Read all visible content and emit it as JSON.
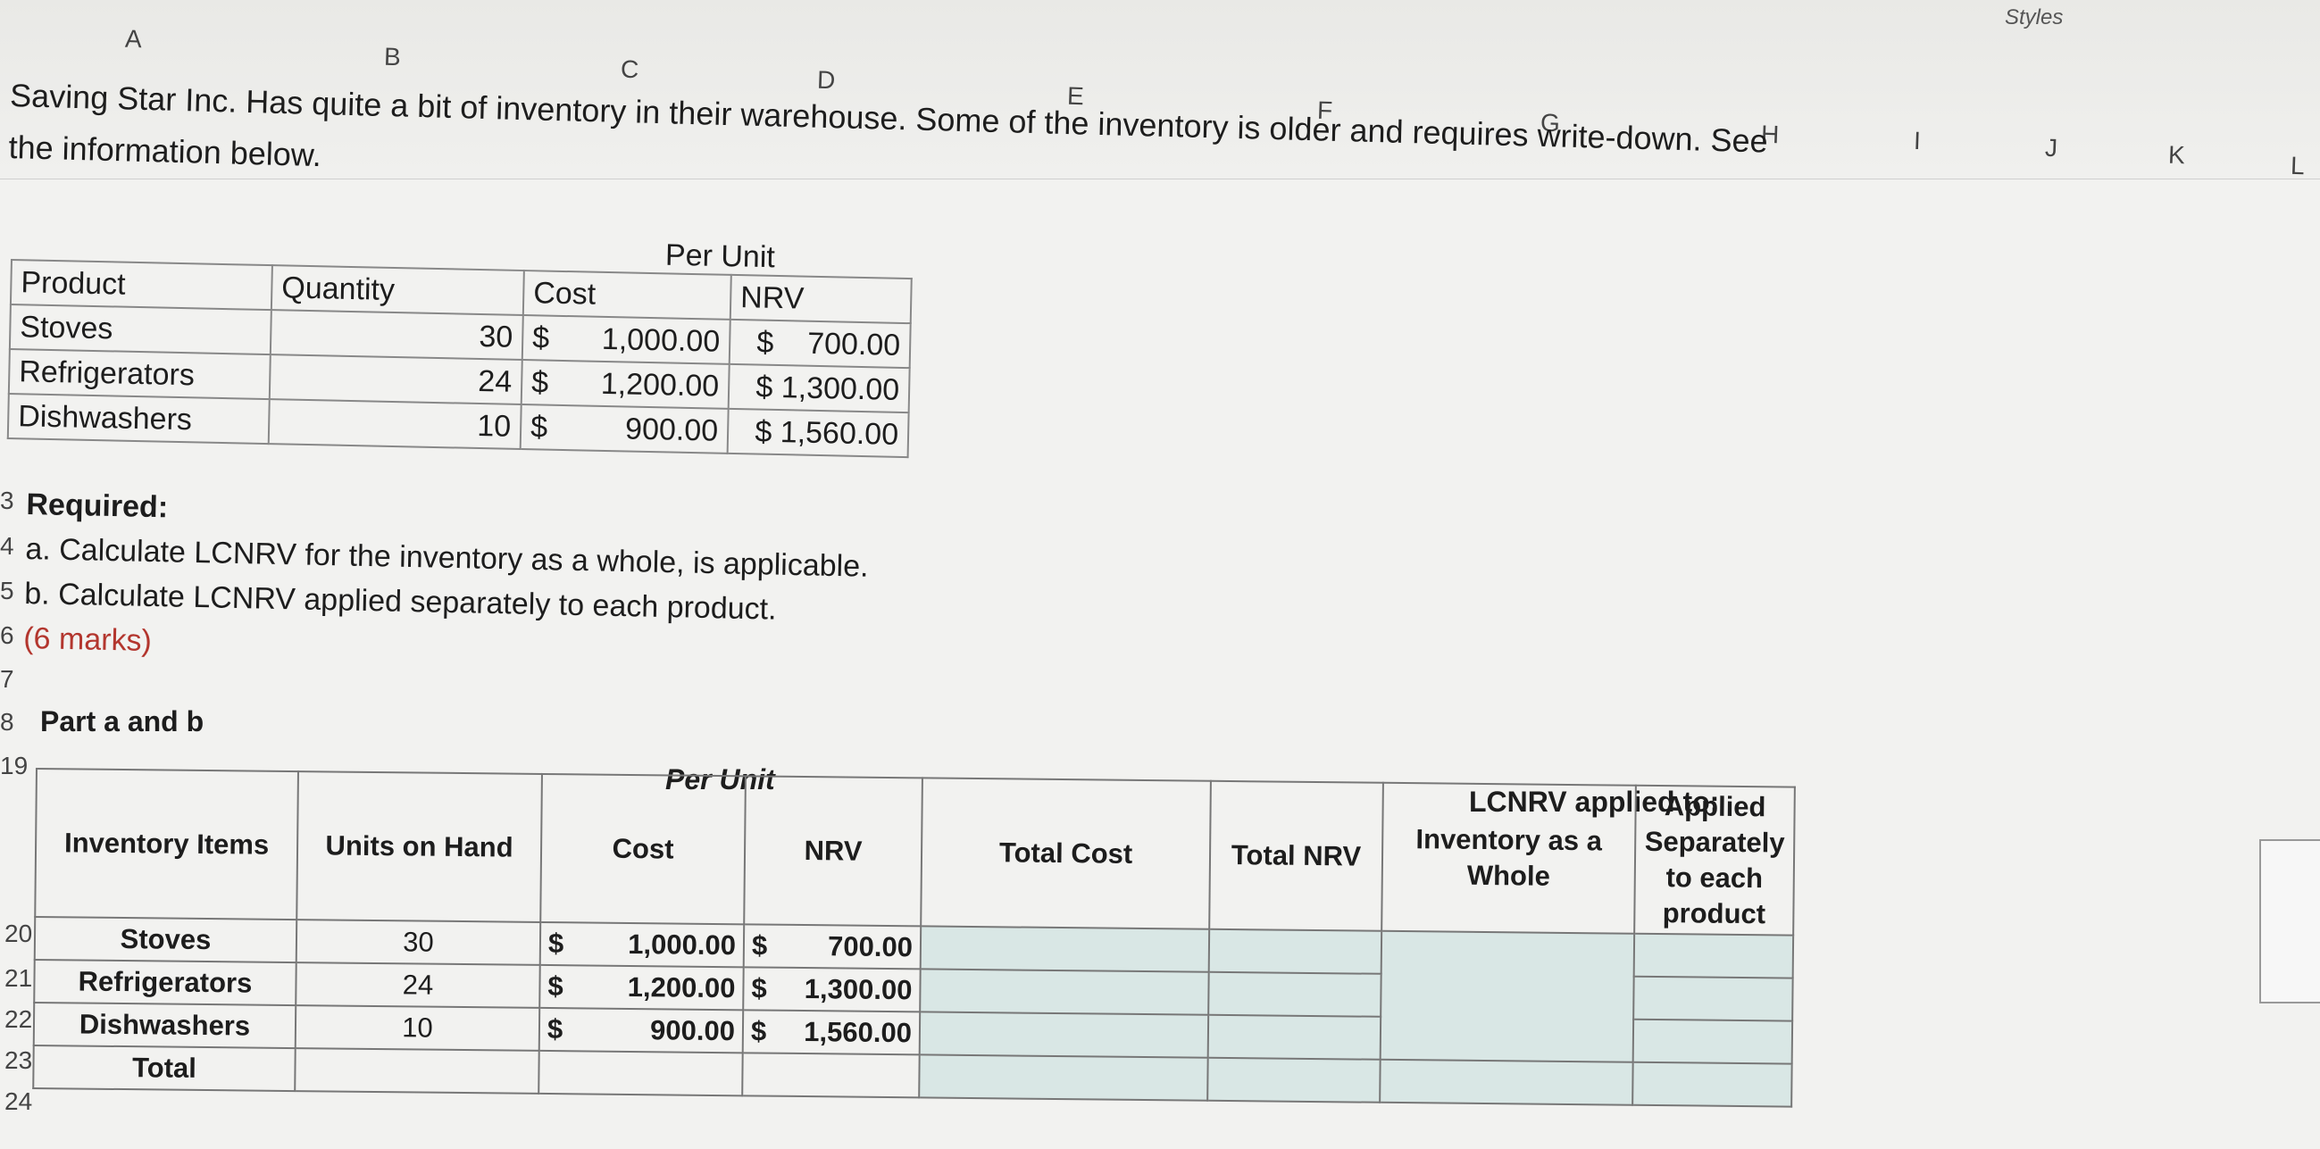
{
  "ribbon": {
    "styles_label": "Styles"
  },
  "columns": [
    "A",
    "B",
    "C",
    "D",
    "E",
    "F",
    "G",
    "H",
    "I",
    "J",
    "K",
    "L"
  ],
  "intro": {
    "line1": "Saving Star Inc. Has quite a bit of inventory in their warehouse. Some of the inventory is older and requires write-down. See",
    "line2": "the information below."
  },
  "table1": {
    "per_unit": "Per Unit",
    "headers": [
      "Product",
      "Quantity",
      "Cost",
      "NRV"
    ],
    "rows": [
      {
        "product": "Stoves",
        "qty": "30",
        "cost_sym": "$",
        "cost": "1,000.00",
        "nrv": "$    700.00"
      },
      {
        "product": "Refrigerators",
        "qty": "24",
        "cost_sym": "$",
        "cost": "1,200.00",
        "nrv": "$ 1,300.00"
      },
      {
        "product": "Dishwashers",
        "qty": "10",
        "cost_sym": "$",
        "cost": "900.00",
        "nrv": "$ 1,560.00"
      }
    ]
  },
  "required": {
    "title": "Required:",
    "a": "a. Calculate LCNRV for the inventory as a whole, is applicable.",
    "b": "b. Calculate LCNRV applied separately to each product.",
    "marks": "(6 marks)"
  },
  "part_label": "Part a and b",
  "row_numbers": {
    "r13": "3",
    "r14": "4",
    "r15": "5",
    "r16": "6",
    "r17": "7",
    "r18": "8",
    "r19": "19",
    "r20": "20",
    "r21": "21",
    "r22": "22",
    "r23": "23",
    "r24": "24"
  },
  "table2": {
    "per_unit": "Per Unit",
    "lcnrv_applied": "LCNRV applied to:",
    "headers": [
      "Inventory Items",
      "Units on Hand",
      "Cost",
      "NRV",
      "Total Cost",
      "Total NRV",
      "Inventory as a Whole",
      "Applied Separately to each product"
    ],
    "rows": [
      {
        "item": "Stoves",
        "units": "30",
        "cost_sym": "$",
        "cost": "1,000.00",
        "nrv_sym": "$",
        "nrv": "700.00"
      },
      {
        "item": "Refrigerators",
        "units": "24",
        "cost_sym": "$",
        "cost": "1,200.00",
        "nrv_sym": "$",
        "nrv": "1,300.00"
      },
      {
        "item": "Dishwashers",
        "units": "10",
        "cost_sym": "$",
        "cost": "900.00",
        "nrv_sym": "$",
        "nrv": "1,560.00"
      }
    ],
    "total_label": "Total"
  }
}
